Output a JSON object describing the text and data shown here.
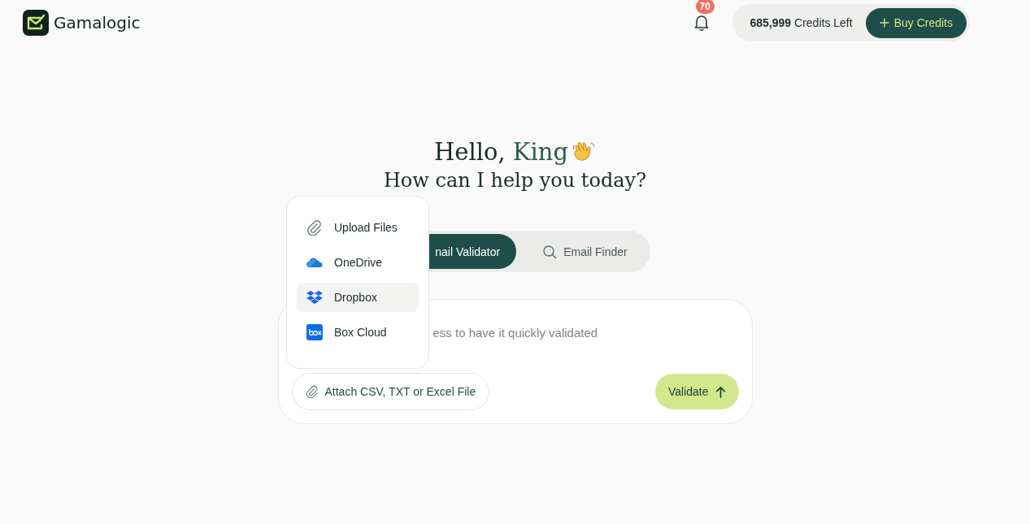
{
  "brand": {
    "name": "Gamalogic"
  },
  "header": {
    "notifications": "70",
    "credits_amount": "685,999",
    "credits_label": "Credits Left",
    "buy_button": "Buy Credits"
  },
  "greeting": {
    "hello": "Hello,",
    "name": "King",
    "subtitle": "How can I help you today?"
  },
  "tabs": [
    {
      "label": "nail Validator",
      "selected": true
    },
    {
      "label": "Email Finder",
      "selected": false
    }
  ],
  "input": {
    "placeholder": "ess to have it quickly validated"
  },
  "attach_button": "Attach CSV, TXT or Excel File",
  "validate_button": "Validate",
  "upload_menu": [
    {
      "kind": "upload",
      "label": "Upload Files",
      "selected": false
    },
    {
      "kind": "onedrive",
      "label": "OneDrive",
      "selected": false
    },
    {
      "kind": "dropbox",
      "label": "Dropbox",
      "selected": true
    },
    {
      "kind": "box",
      "label": "Box Cloud",
      "selected": false
    }
  ]
}
